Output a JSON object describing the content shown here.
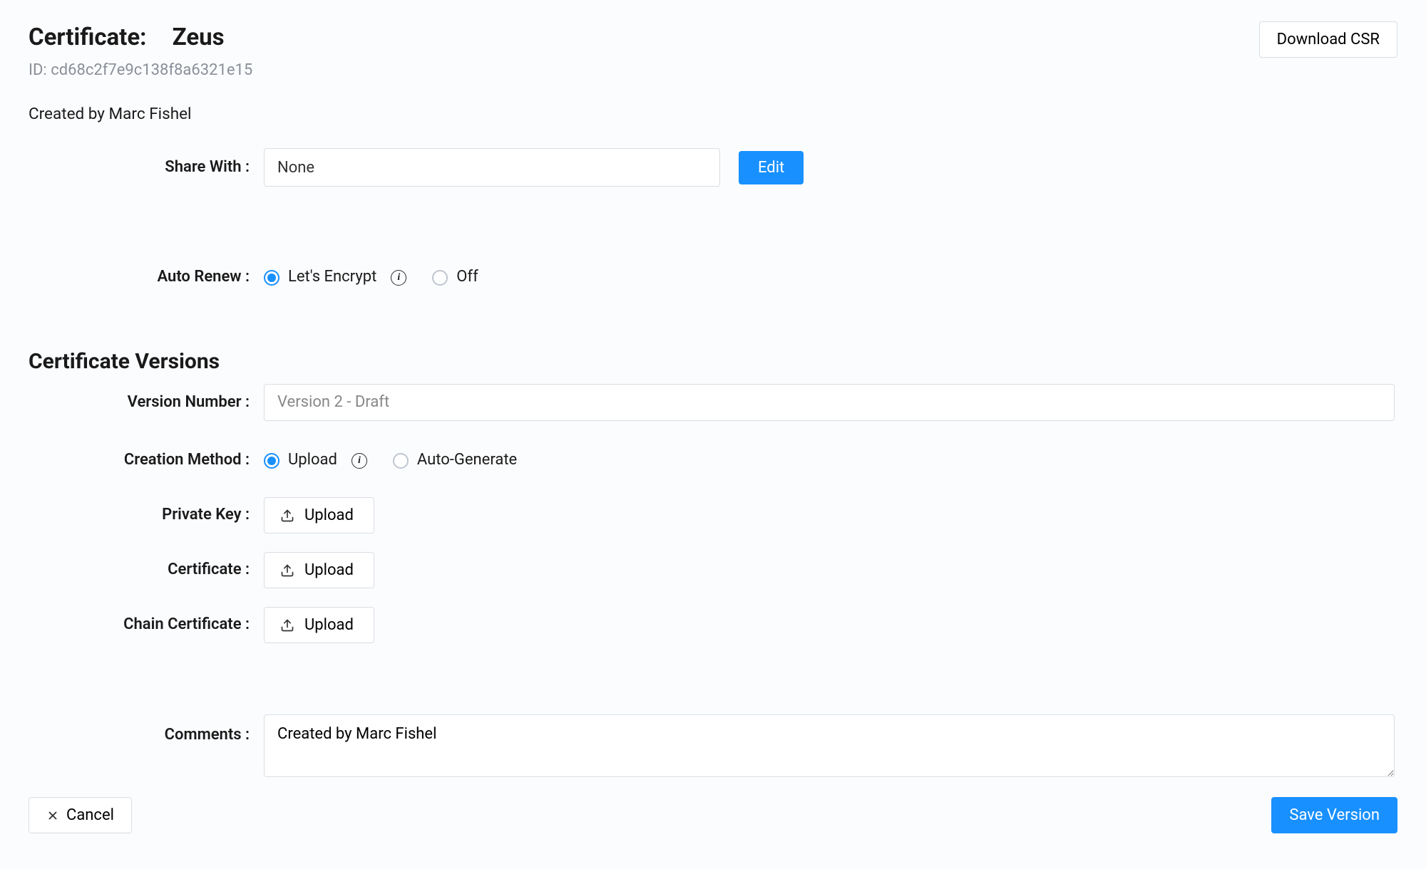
{
  "header": {
    "title_prefix": "Certificate:",
    "cert_name": "Zeus",
    "id_prefix": "ID: ",
    "id_value": "cd68c2f7e9c138f8a6321e15",
    "download_csr": "Download CSR"
  },
  "created_by": "Created by Marc Fishel",
  "share": {
    "label": "Share With :",
    "value": "None",
    "edit": "Edit"
  },
  "auto_renew": {
    "label": "Auto Renew :",
    "lets_encrypt": "Let's Encrypt",
    "off": "Off",
    "selected": "lets_encrypt"
  },
  "versions": {
    "section_title": "Certificate Versions",
    "version_number_label": "Version Number :",
    "version_number_value": "Version 2 - Draft",
    "creation_method_label": "Creation Method :",
    "upload": "Upload",
    "auto_generate": "Auto-Generate",
    "creation_selected": "upload",
    "private_key_label": "Private Key :",
    "certificate_label": "Certificate :",
    "chain_label": "Chain Certificate :",
    "upload_btn": "Upload"
  },
  "comments": {
    "label": "Comments :",
    "value": "Created by Marc Fishel"
  },
  "footer": {
    "cancel": "Cancel",
    "save": "Save Version"
  }
}
